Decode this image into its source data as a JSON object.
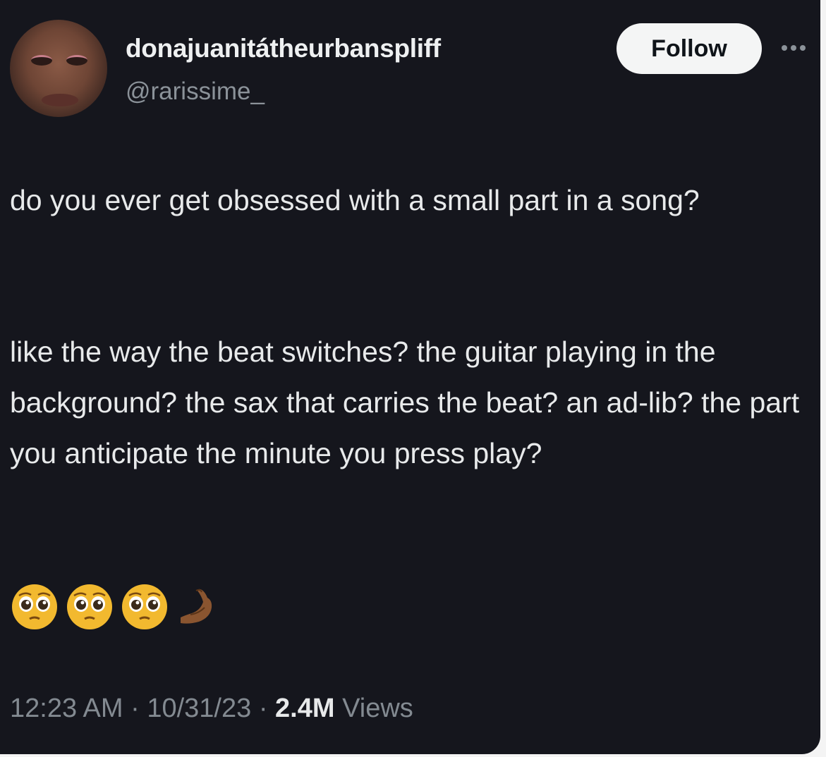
{
  "author": {
    "display_name": "donajuanitátheurbanspliff",
    "handle": "@rarissime_"
  },
  "follow_label": "Follow",
  "tweet": {
    "paragraph_1": "do you ever get obsessed with a small part in a song?",
    "paragraph_2": "like the way the beat switches? the guitar playing in the background? the sax that carries the beat? an ad-lib? the part you anticipate the minute you press play?",
    "emojis": [
      "pleading-face",
      "pleading-face",
      "pleading-face",
      "pinched-fingers-hand"
    ]
  },
  "meta": {
    "time": "12:23 AM",
    "separator": "·",
    "date": "10/31/23",
    "views_count": "2.4M",
    "views_label": "Views"
  },
  "colors": {
    "background": "#15161d",
    "text": "#e8eaeb",
    "muted": "#838a91",
    "follow_button_bg": "#f4f5f5"
  }
}
